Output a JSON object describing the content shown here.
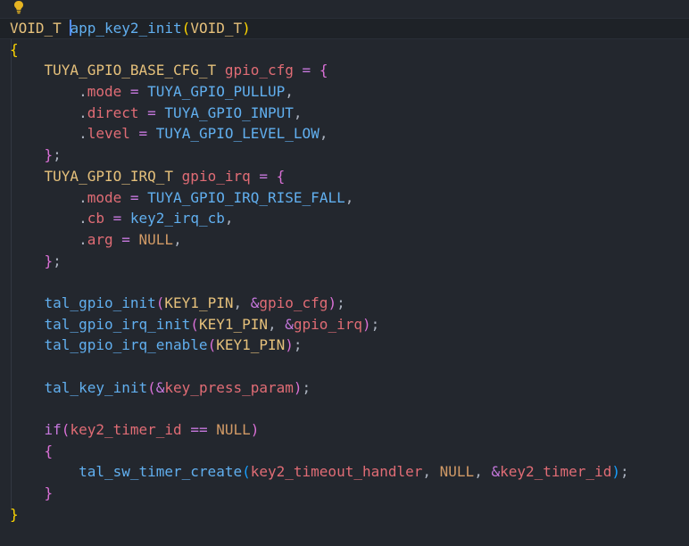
{
  "colors": {
    "background": "#23272e",
    "current_line": "#1e2227",
    "type": "#e5c07b",
    "function": "#61afef",
    "variable": "#e06c75",
    "operator": "#c678dd",
    "null": "#d19a66",
    "punctuation": "#abb2bf",
    "bracket1": "#ffd700",
    "bracket2": "#da70d6",
    "bracket3": "#179fff"
  },
  "lightbulb": {
    "icon": "lightbulb-icon"
  },
  "code": {
    "line1": {
      "ret_type": "VOID_T",
      "func": "app_key2_init",
      "open": "(",
      "param": "VOID_T",
      "close": ")"
    },
    "line2": {
      "brace": "{"
    },
    "line3": {
      "type": "TUYA_GPIO_BASE_CFG_T",
      "var": "gpio_cfg",
      "eq": "=",
      "brace": "{"
    },
    "line4": {
      "dot": ".",
      "member": "mode",
      "eq": "=",
      "value": "TUYA_GPIO_PULLUP",
      "comma": ","
    },
    "line5": {
      "dot": ".",
      "member": "direct",
      "eq": "=",
      "value": "TUYA_GPIO_INPUT",
      "comma": ","
    },
    "line6": {
      "dot": ".",
      "member": "level",
      "eq": "=",
      "value": "TUYA_GPIO_LEVEL_LOW",
      "comma": ","
    },
    "line7": {
      "brace": "}",
      "semi": ";"
    },
    "line8": {
      "type": "TUYA_GPIO_IRQ_T",
      "var": "gpio_irq",
      "eq": "=",
      "brace": "{"
    },
    "line9": {
      "dot": ".",
      "member": "mode",
      "eq": "=",
      "value": "TUYA_GPIO_IRQ_RISE_FALL",
      "comma": ","
    },
    "line10": {
      "dot": ".",
      "member": "cb",
      "eq": "=",
      "value": "key2_irq_cb",
      "comma": ","
    },
    "line11": {
      "dot": ".",
      "member": "arg",
      "eq": "=",
      "value": "NULL",
      "comma": ","
    },
    "line12": {
      "brace": "}",
      "semi": ";"
    },
    "line14": {
      "func": "tal_gpio_init",
      "open": "(",
      "arg1": "KEY1_PIN",
      "sep": ", ",
      "amp": "&",
      "arg2": "gpio_cfg",
      "close": ")",
      "semi": ";"
    },
    "line15": {
      "func": "tal_gpio_irq_init",
      "open": "(",
      "arg1": "KEY1_PIN",
      "sep": ", ",
      "amp": "&",
      "arg2": "gpio_irq",
      "close": ")",
      "semi": ";"
    },
    "line16": {
      "func": "tal_gpio_irq_enable",
      "open": "(",
      "arg1": "KEY1_PIN",
      "close": ")",
      "semi": ";"
    },
    "line18": {
      "func": "tal_key_init",
      "open": "(",
      "amp": "&",
      "arg1": "key_press_param",
      "close": ")",
      "semi": ";"
    },
    "line20": {
      "kw": "if",
      "open": "(",
      "var": "key2_timer_id",
      "op": "==",
      "null": "NULL",
      "close": ")"
    },
    "line21": {
      "brace": "{"
    },
    "line22": {
      "func": "tal_sw_timer_create",
      "open": "(",
      "arg1": "key2_timeout_handler",
      "sep1": ", ",
      "null": "NULL",
      "sep2": ", ",
      "amp": "&",
      "arg2": "key2_timer_id",
      "close": ")",
      "semi": ";"
    },
    "line23": {
      "brace": "}"
    },
    "line24": {
      "brace": "}"
    }
  }
}
